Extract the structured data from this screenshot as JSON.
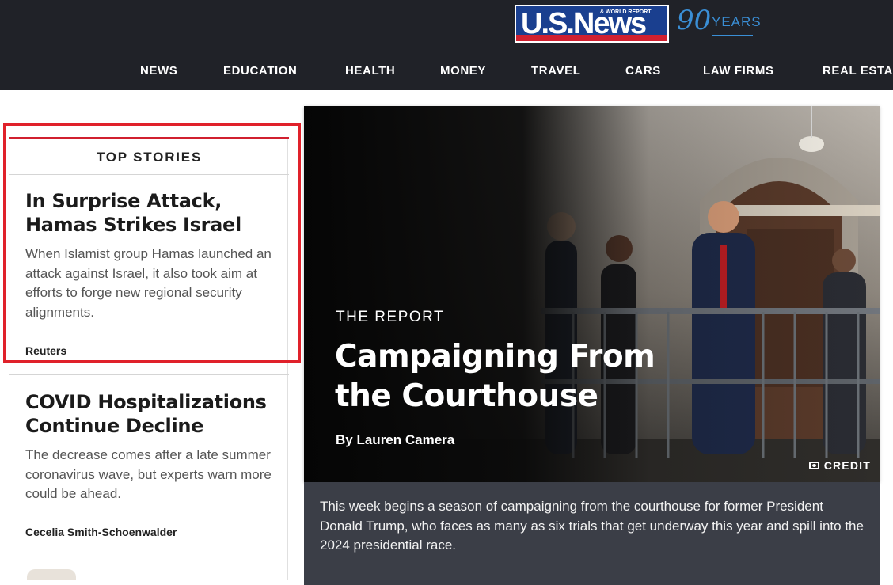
{
  "brand": {
    "logo_text": "U.S.News",
    "logo_subtext": "& WORLD REPORT",
    "anniversary_number": "90",
    "anniversary_label": "YEARS",
    "colors": {
      "bar": "#202228",
      "logo_blue": "#1a3f8f",
      "logo_red": "#d1202f",
      "accent_blue": "#3a8fd6"
    }
  },
  "nav": {
    "items": [
      "NEWS",
      "EDUCATION",
      "HEALTH",
      "MONEY",
      "TRAVEL",
      "CARS",
      "LAW FIRMS",
      "REAL ESTA"
    ]
  },
  "top_stories": {
    "header": "TOP STORIES",
    "stories": [
      {
        "headline": "In Surprise Attack, Hamas Strikes Israel",
        "dek": "When Islamist group Hamas launched an attack against Israel, it also took aim at efforts to forge new regional security alignments.",
        "source": "Reuters"
      },
      {
        "headline": "COVID Hospitalizations Continue Decline",
        "dek": "The decrease comes after a late summer coronavirus wave, but experts warn more could be ahead.",
        "source": "Cecelia Smith-Schoenwalder"
      }
    ]
  },
  "hero": {
    "kicker": "THE REPORT",
    "title": "Campaigning From the Courthouse",
    "byline_prefix": "By",
    "author": "Lauren Camera",
    "credit_label": "CREDIT",
    "credit_icon": "camera-icon",
    "caption": "This week begins a season of campaigning from the courthouse for former President Donald Trump, who faces as many as six trials that get underway this year and spill into the 2024 presidential race."
  },
  "highlight_color": "#e0212a"
}
